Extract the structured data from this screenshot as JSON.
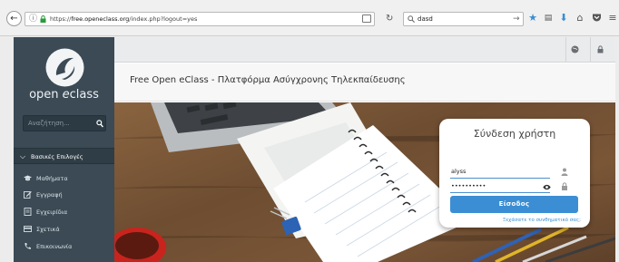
{
  "browser": {
    "url_prefix": "https://",
    "url_host": "free.openeclass.org",
    "url_path": "/index.php?logout=yes",
    "search_value": "dasd",
    "colors": {
      "star": "#3b8ed3",
      "download": "#3b8ed3"
    },
    "icons": [
      "back-arrow-icon",
      "info-icon",
      "lock-icon",
      "reader-view-icon",
      "reload-icon",
      "search-icon",
      "forward-arrow-icon",
      "bookmark-star-icon",
      "library-icon",
      "download-icon",
      "home-icon",
      "pocket-icon",
      "menu-icon"
    ]
  },
  "sidebar": {
    "logo_text_1": "open ",
    "logo_text_2": "e",
    "logo_text_3": "class",
    "search_placeholder": "Αναζήτηση...",
    "section_label": "Βασικές Επιλογές",
    "items": [
      {
        "label": "Μαθήματα",
        "icon": "graduation-cap-icon"
      },
      {
        "label": "Εγγραφή",
        "icon": "edit-icon"
      },
      {
        "label": "Εγχειρίδια",
        "icon": "manual-icon"
      },
      {
        "label": "Σχετικά",
        "icon": "credit-card-icon"
      },
      {
        "label": "Επικοινωνία",
        "icon": "phone-icon"
      }
    ]
  },
  "header": {
    "title": "Free Open eClass - Πλατφόρμα Ασύγχρονης Τηλεκπαίδευσης",
    "icons": [
      "globe-icon",
      "lock-icon"
    ]
  },
  "login": {
    "title": "Σύνδεση χρήστη",
    "username_value": "alyss",
    "password_value": "••••••••••",
    "submit_label": "Είσοδος",
    "forgot_link": "Ξεχάσατε το συνθηματικό σας;",
    "accent_color": "#3b8ed3"
  }
}
